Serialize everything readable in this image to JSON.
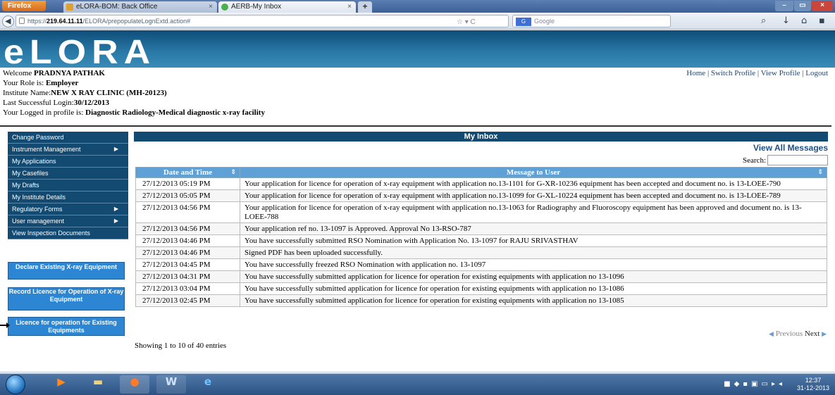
{
  "browser": {
    "firefox_label": "Firefox",
    "tabs": [
      {
        "title": "eLORA-BOM: Back Office"
      },
      {
        "title": "AERB-My Inbox"
      }
    ],
    "url_prefix": "https://",
    "url_host": "219.64.11.11",
    "url_path": "/ELORA/prepopulateLognExtd.action#",
    "search_placeholder": "Google"
  },
  "app": {
    "logo": "eLORA",
    "welcome_label": "Welcome ",
    "user_name": "PRADNYA PATHAK",
    "role_label": "Your Role is: ",
    "role": "Employer",
    "institute_label": "Institute Name:",
    "institute": "NEW X RAY CLINIC (MH-20123)",
    "login_label": "Last Successful Login:",
    "login_date": "30/12/2013",
    "profile_label": "Your Logged in profile is: ",
    "profile": "Diagnostic Radiology-Medical diagnostic x-ray facility",
    "top_links": [
      "Home",
      "Switch Profile",
      "View Profile",
      "Logout"
    ]
  },
  "sidebar": {
    "items": [
      {
        "label": "Change Password",
        "arrow": ""
      },
      {
        "label": "Instrument Management",
        "arrow": "▶"
      },
      {
        "label": "My Applications",
        "arrow": ""
      },
      {
        "label": "My Casefiles",
        "arrow": ""
      },
      {
        "label": "My Drafts",
        "arrow": ""
      },
      {
        "label": "My Institute Details",
        "arrow": ""
      },
      {
        "label": "Regulatory Forms",
        "arrow": "▶"
      },
      {
        "label": "User management",
        "arrow": "▶"
      },
      {
        "label": "View Inspection Documents",
        "arrow": ""
      }
    ],
    "buttons": [
      "Declare Existing X-ray Equipment",
      "Record Licence for Operation of X-ray Equipment",
      "Licence for operation for Existing Equipments"
    ]
  },
  "inbox": {
    "title": "My Inbox",
    "view_all": "View All Messages",
    "search_label": "Search:",
    "columns": [
      "Date and Time",
      "Message to User"
    ],
    "rows": [
      [
        "27/12/2013 05:19 PM",
        "Your application for licence for operation of x-ray equipment with application no.13-1101 for G-XR-10236 equipment has been accepted and document no. is 13-LOEE-790"
      ],
      [
        "27/12/2013 05:05 PM",
        "Your application for licence for operation of x-ray equipment with application no.13-1099 for G-XL-10224 equipment has been accepted and document no. is 13-LOEE-789"
      ],
      [
        "27/12/2013 04:56 PM",
        "Your application for licence for operation of x-ray equipment with application no.13-1063 for Radiography and Fluoroscopy equipment has been approved and document no. is 13-LOEE-788"
      ],
      [
        "27/12/2013 04:56 PM",
        "Your application ref no. 13-1097 is Approved. Approval No 13-RSO-787"
      ],
      [
        "27/12/2013 04:46 PM",
        "You have successfully submitted RSO Nomination with Application No. 13-1097 for RAJU SRIVASTHAV"
      ],
      [
        "27/12/2013 04:46 PM",
        "Signed PDF has been uploaded successfully."
      ],
      [
        "27/12/2013 04:45 PM",
        "You have successfully freezed RSO Nomination with application no. 13-1097"
      ],
      [
        "27/12/2013 04:31 PM",
        "You have successfully submitted application for licence for operation for existing equipments with application no 13-1096"
      ],
      [
        "27/12/2013 03:04 PM",
        "You have successfully submitted application for licence for operation for existing equipments with application no 13-1086"
      ],
      [
        "27/12/2013 02:45 PM",
        "You have successfully submitted application for licence for operation for existing equipments with application no 13-1085"
      ]
    ],
    "prev_label": "Previous",
    "next_label": "Next",
    "showing": "Showing 1 to 10 of 40 entries"
  },
  "taskbar": {
    "time": "12:37",
    "date": "31-12-2013"
  }
}
